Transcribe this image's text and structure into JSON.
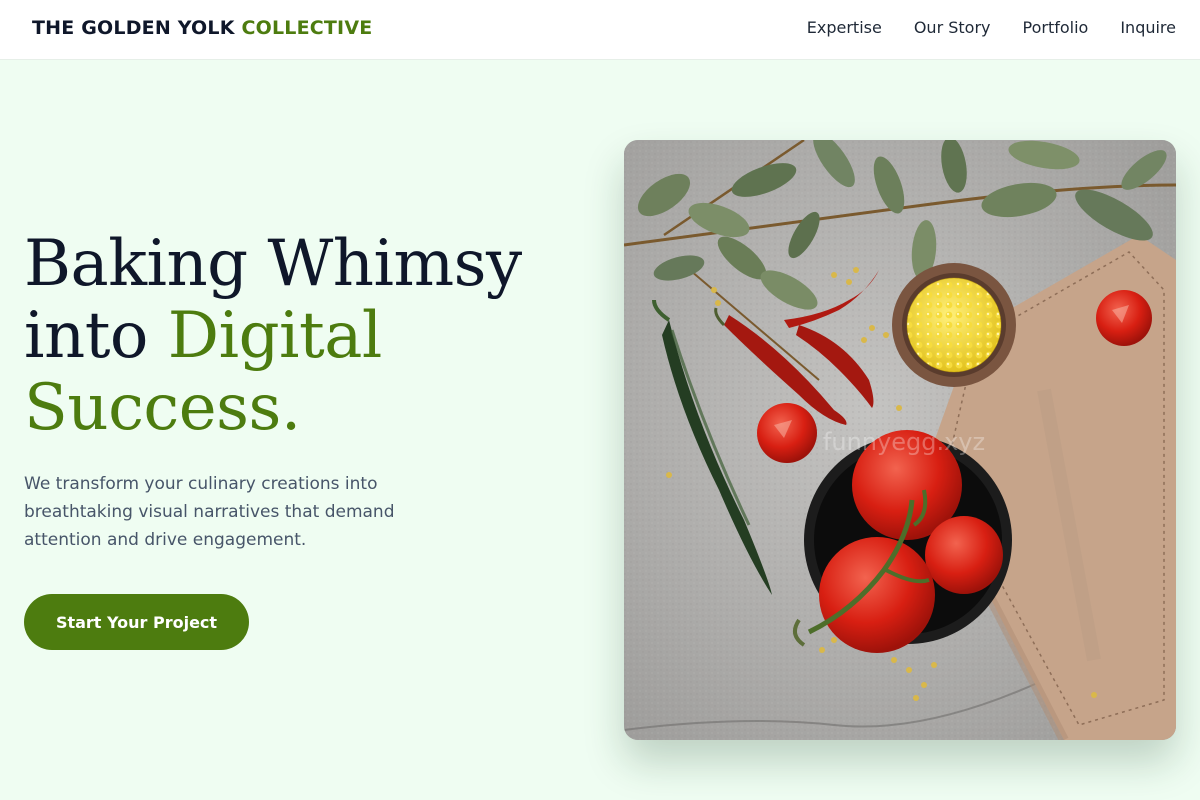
{
  "header": {
    "logo_main": "THE GOLDEN YOLK",
    "logo_accent": "COLLECTIVE",
    "nav": [
      {
        "label": "Expertise"
      },
      {
        "label": "Our Story"
      },
      {
        "label": "Portfolio"
      },
      {
        "label": "Inquire"
      }
    ]
  },
  "hero": {
    "title_line1": "Baking Whimsy",
    "title_line2_plain": "into",
    "title_line2_accent": "Digital",
    "title_line3_accent": "Success.",
    "description": "We transform your culinary creations into breathtaking visual narratives that demand attention and drive engagement.",
    "cta_label": "Start Your Project",
    "image_watermark": "funnyegg.xyz"
  },
  "colors": {
    "accent": "#4d7c0f",
    "background": "#effdf2",
    "text_dark": "#0f172a",
    "text_muted": "#475569"
  }
}
